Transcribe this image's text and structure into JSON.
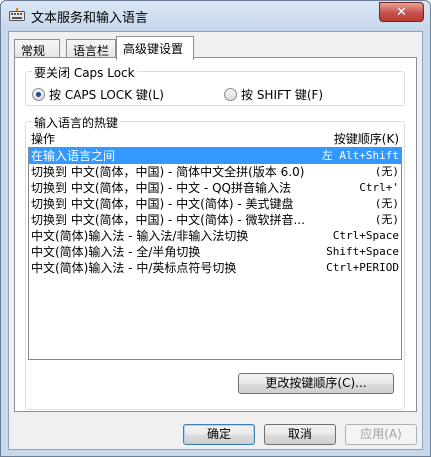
{
  "window": {
    "title": "文本服务和输入语言",
    "close_glyph": "✕"
  },
  "tabs": [
    {
      "label": "常规"
    },
    {
      "label": "语言栏"
    },
    {
      "label": "高级键设置"
    }
  ],
  "capslock": {
    "group_label": "要关闭 Caps Lock",
    "options": [
      {
        "label": "按 CAPS LOCK 键(L)",
        "checked": true
      },
      {
        "label": "按 SHIFT 键(F)",
        "checked": false
      }
    ]
  },
  "hotkeys": {
    "group_label": "输入语言的热键",
    "col_action": "操作",
    "col_sequence": "按键顺序(K)",
    "rows": [
      {
        "action": "在输入语言之间",
        "keys": "左 Alt+Shift",
        "selected": true
      },
      {
        "action": "切换到 中文(简体，中国) - 简体中文全拼(版本 6.0)",
        "keys": "(无)"
      },
      {
        "action": "切换到 中文(简体，中国) - 中文 - QQ拼音输入法",
        "keys": "Ctrl+'"
      },
      {
        "action": "切换到 中文(简体，中国) - 中文(简体) - 美式键盘",
        "keys": "(无)"
      },
      {
        "action": "切换到 中文(简体，中国) - 中文(简体) - 微软拼音...",
        "keys": "(无)"
      },
      {
        "action": "中文(简体)输入法 - 输入法/非输入法切换",
        "keys": "Ctrl+Space"
      },
      {
        "action": "中文(简体)输入法 - 全/半角切换",
        "keys": "Shift+Space"
      },
      {
        "action": "中文(简体)输入法 - 中/英标点符号切换",
        "keys": "Ctrl+PERIOD"
      }
    ],
    "change_button": "更改按键顺序(C)..."
  },
  "footer": {
    "ok": "确定",
    "cancel": "取消",
    "apply": "应用(A)"
  }
}
